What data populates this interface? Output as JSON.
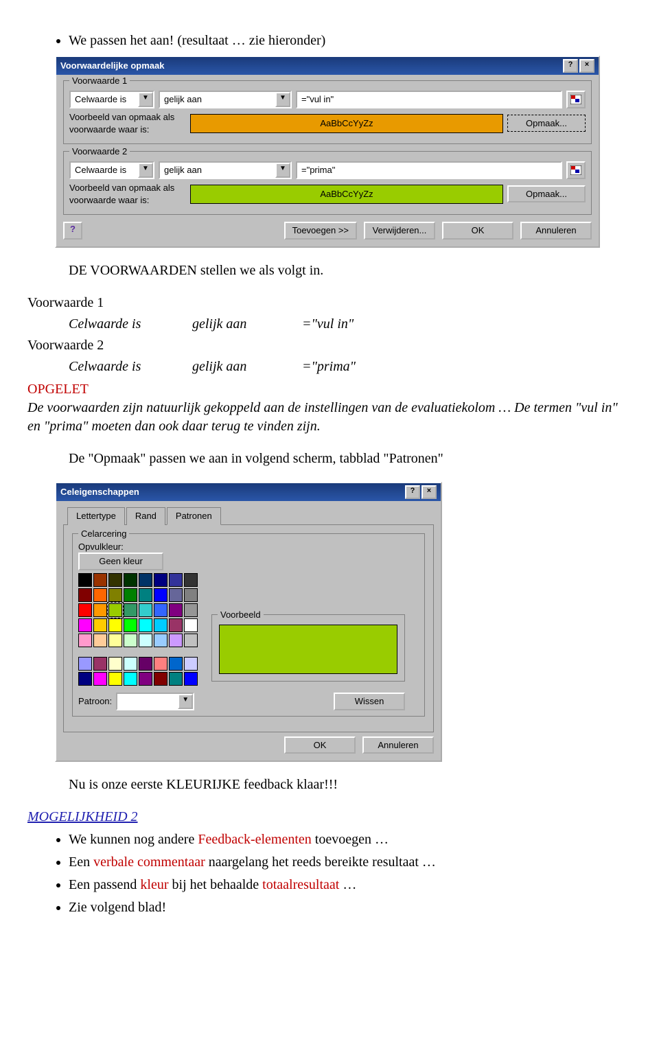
{
  "doc": {
    "bullet_intro": "We passen het aan! (resultaat … zie hieronder)",
    "line_stellen": "DE VOORWAARDEN stellen we als volgt in.",
    "vw1_head": "Voorwaarde 1",
    "vw1_c1": "Celwaarde is",
    "vw1_c2": "gelijk aan",
    "vw1_c3": "=\"vul in\"",
    "vw2_head": "Voorwaarde 2",
    "vw2_c1": "Celwaarde is",
    "vw2_c2": "gelijk aan",
    "vw2_c3": "=\"prima\"",
    "opgelet": "OPGELET",
    "opgelet_line1": "De voorwaarden zijn natuurlijk gekoppeld aan de instellingen van de evaluatiekolom … De termen \"vul in\" en \"prima\" moeten dan ook daar terug te vinden zijn.",
    "opmaak_line": "De \"Opmaak\" passen we aan in volgend scherm, tabblad \"Patronen\"",
    "feedback_line": "Nu is onze eerste KLEURIJKE feedback klaar!!!",
    "mog2_head": "MOGELIJKHEID 2",
    "mog2_b1a": "We kunnen nog andere ",
    "mog2_b1b": "Feedback-elementen",
    "mog2_b1c": " toevoegen …",
    "mog2_b2a": "Een ",
    "mog2_b2b": "verbale commentaar",
    "mog2_b2c": " naargelang het reeds bereikte resultaat …",
    "mog2_b3a": "Een passend ",
    "mog2_b3b": "kleur",
    "mog2_b3c": " bij het behaalde ",
    "mog2_b3d": "totaalresultaat",
    "mog2_b3e": " …",
    "mog2_b4": "Zie volgend blad!"
  },
  "dlg1": {
    "title": "Voorwaardelijke opmaak",
    "cond1": {
      "legend": "Voorwaarde 1",
      "combo1": "Celwaarde is",
      "combo2": "gelijk aan",
      "value": "=\"vul in\"",
      "preview_label": "Voorbeeld van opmaak als voorwaarde waar is:",
      "sample": "AaBbCcYyZz",
      "opmaak_btn": "Opmaak..."
    },
    "cond2": {
      "legend": "Voorwaarde 2",
      "combo1": "Celwaarde is",
      "combo2": "gelijk aan",
      "value": "=\"prima\"",
      "preview_label": "Voorbeeld van opmaak als voorwaarde waar is:",
      "sample": "AaBbCcYyZz",
      "opmaak_btn": "Opmaak..."
    },
    "buttons": {
      "toevoegen": "Toevoegen >>",
      "verwijderen": "Verwijderen...",
      "ok": "OK",
      "annuleren": "Annuleren"
    }
  },
  "dlg2": {
    "title": "Celeigenschappen",
    "tabs": {
      "lettertype": "Lettertype",
      "rand": "Rand",
      "patronen": "Patronen"
    },
    "celarcering_legend": "Celarcering",
    "opvulkleur_label": "Opvulkleur:",
    "geen_kleur": "Geen kleur",
    "voorbeeld_label": "Voorbeeld",
    "patroon_label": "Patroon:",
    "wissen": "Wissen",
    "ok": "OK",
    "annuleren": "Annuleren",
    "palette_rows": [
      [
        "#000000",
        "#993300",
        "#333300",
        "#003300",
        "#003366",
        "#000080",
        "#333399",
        "#333333"
      ],
      [
        "#800000",
        "#ff6600",
        "#808000",
        "#008000",
        "#008080",
        "#0000ff",
        "#666699",
        "#808080"
      ],
      [
        "#ff0000",
        "#ff9900",
        "#99cc00",
        "#339966",
        "#33cccc",
        "#3366ff",
        "#800080",
        "#969696"
      ],
      [
        "#ff00ff",
        "#ffcc00",
        "#ffff00",
        "#00ff00",
        "#00ffff",
        "#00ccff",
        "#993366",
        "#ffffff"
      ],
      [
        "#ff99cc",
        "#ffcc99",
        "#ffff99",
        "#ccffcc",
        "#ccffff",
        "#99ccff",
        "#cc99ff",
        "#c0c0c0"
      ]
    ],
    "palette_extra": [
      [
        "#9999ff",
        "#993366",
        "#ffffcc",
        "#ccffff",
        "#660066",
        "#ff8080",
        "#0066cc",
        "#ccccff"
      ],
      [
        "#000080",
        "#ff00ff",
        "#ffff00",
        "#00ffff",
        "#800080",
        "#800000",
        "#008080",
        "#0000ff"
      ]
    ],
    "selected_index": [
      2,
      2
    ]
  }
}
